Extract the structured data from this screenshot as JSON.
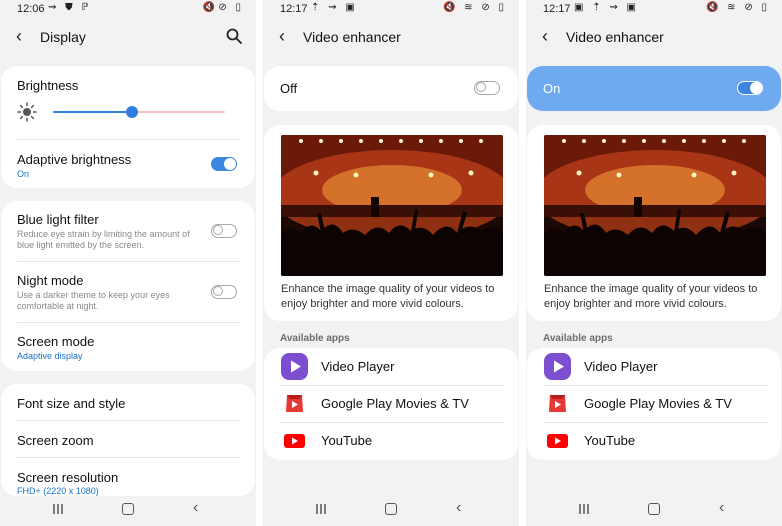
{
  "panel1": {
    "status": {
      "time": "12:06",
      "left_icons": "⇝ ⛊ ℙ",
      "right_icons": "🔇⊘ ▯"
    },
    "header": {
      "title": "Display",
      "back_icon": "chevron-left-icon",
      "search_icon": "search-icon"
    },
    "brightness": {
      "label": "Brightness",
      "level": 0.46
    },
    "adaptive": {
      "label": "Adaptive brightness",
      "value": "On",
      "toggle": "on"
    },
    "blue_light": {
      "label": "Blue light filter",
      "sub": "Reduce eye strain by limiting the amount of blue light emitted by the screen.",
      "toggle": "off"
    },
    "night_mode": {
      "label": "Night mode",
      "sub": "Use a darker theme to keep your eyes comfortable at night.",
      "toggle": "off"
    },
    "screen_mode": {
      "label": "Screen mode",
      "value": "Adaptive display"
    },
    "font_size": {
      "label": "Font size and style"
    },
    "screen_zoom": {
      "label": "Screen zoom"
    },
    "screen_resolution": {
      "label": "Screen resolution",
      "value": "FHD+ (2220 x 1080)"
    }
  },
  "panel2": {
    "status": {
      "time": "12:17",
      "left_icons": "⇡ ⇝ ▣",
      "right_icons": "🔇 ≋ ⊘ ▯"
    },
    "header": {
      "title": "Video enhancer"
    },
    "master": {
      "label": "Off",
      "toggle": "off"
    },
    "description": "Enhance the image quality of your videos to enjoy brighter and more vivid colours.",
    "available_label": "Available apps",
    "apps": [
      {
        "name": "Video Player",
        "icon": "video-player-icon"
      },
      {
        "name": "Google Play Movies & TV",
        "icon": "play-movies-icon"
      },
      {
        "name": "YouTube",
        "icon": "youtube-icon"
      }
    ]
  },
  "panel3": {
    "status": {
      "time": "12:17",
      "left_icons": "▣ ⇡ ⇝ ▣",
      "right_icons": "🔇 ≋ ⊘ ▯"
    },
    "header": {
      "title": "Video enhancer"
    },
    "master": {
      "label": "On",
      "toggle": "on"
    },
    "description": "Enhance the image quality of your videos to enjoy brighter and more vivid colours.",
    "available_label": "Available apps",
    "apps": [
      {
        "name": "Video Player",
        "icon": "video-player-icon"
      },
      {
        "name": "Google Play Movies & TV",
        "icon": "play-movies-icon"
      },
      {
        "name": "YouTube",
        "icon": "youtube-icon"
      }
    ]
  },
  "colors": {
    "accent": "#3b86e0",
    "on_banner": "#6fa9f0",
    "link": "#1a73c9"
  }
}
